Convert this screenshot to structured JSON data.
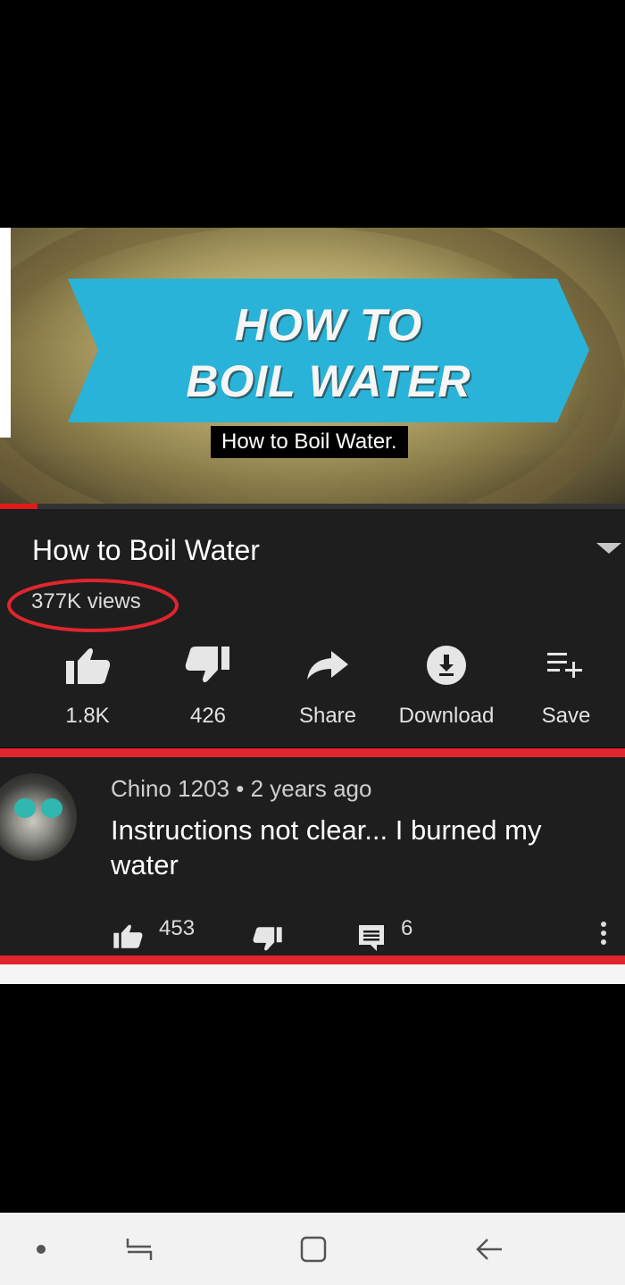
{
  "video": {
    "thumbnail_title_line1": "HOW TO",
    "thumbnail_title_line2": "BOIL WATER",
    "caption": "How to Boil Water.",
    "banner_color": "#29b3d8",
    "progress_fraction": 0.06
  },
  "info": {
    "title": "How to Boil Water",
    "views": "377K views",
    "highlight_color": "#e0252e"
  },
  "actions": [
    {
      "icon": "thumbs-up-icon",
      "label": "1.8K"
    },
    {
      "icon": "thumbs-down-icon",
      "label": "426"
    },
    {
      "icon": "share-icon",
      "label": "Share"
    },
    {
      "icon": "download-icon",
      "label": "Download"
    },
    {
      "icon": "add-to-playlist-icon",
      "label": "Save"
    }
  ],
  "comment": {
    "author": "Chino 1203",
    "age": "2 years ago",
    "meta_separator": "•",
    "text": "Instructions not clear... I burned my water",
    "likes": "453",
    "replies": "6"
  },
  "nav": [
    "dot-icon",
    "recent-apps-icon",
    "home-icon",
    "back-icon"
  ]
}
